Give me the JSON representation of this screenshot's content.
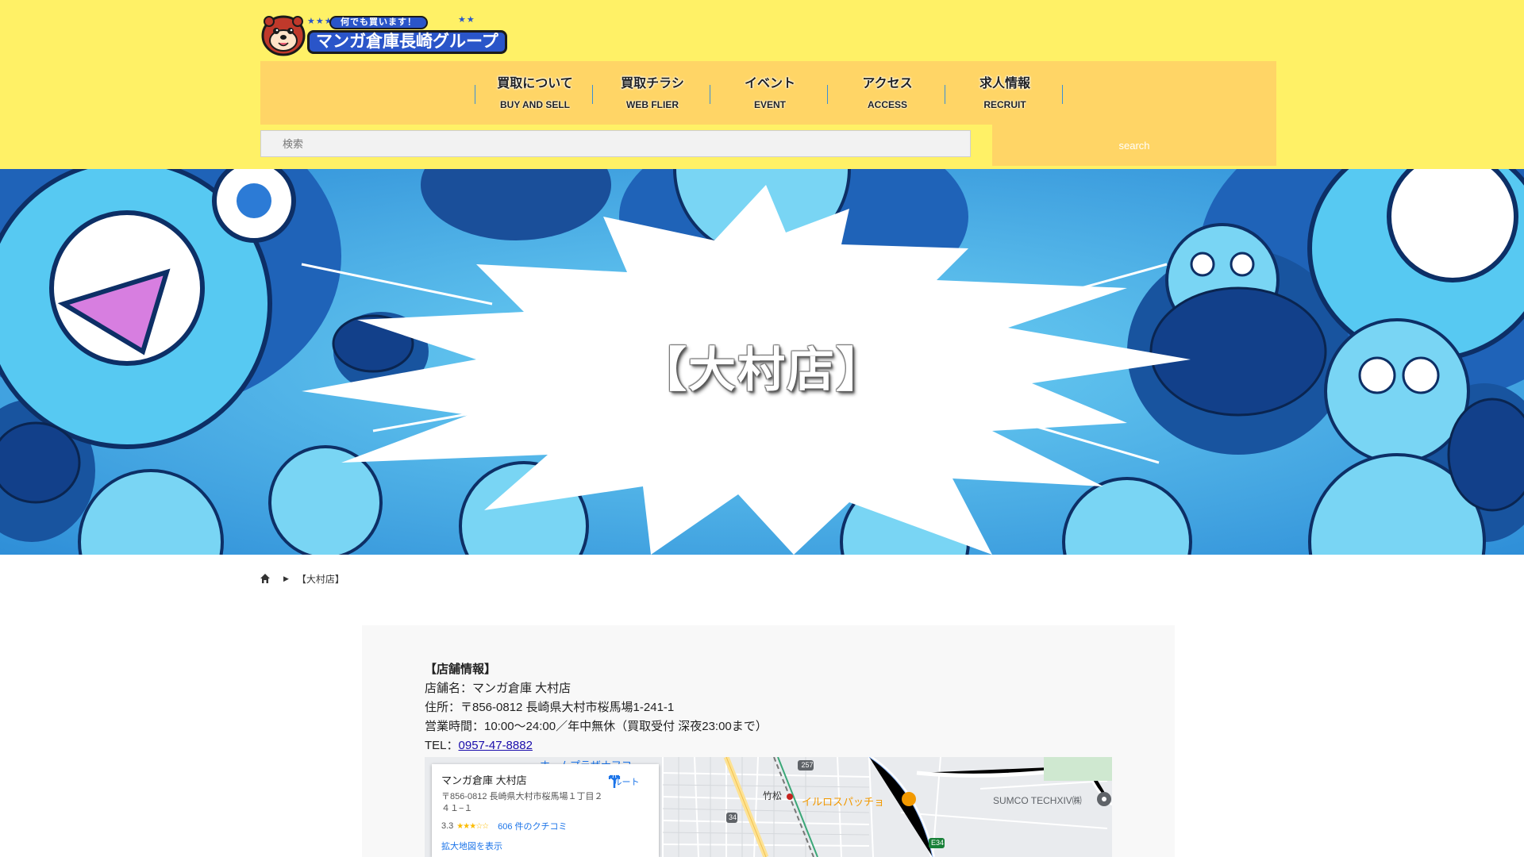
{
  "header": {
    "logo": {
      "tagline": "何でも買います！",
      "name": "マンガ倉庫長崎グループ",
      "stars_left": "★★★",
      "stars_right": "★★"
    },
    "nav": [
      {
        "jp": "買取について",
        "en": "BUY AND SELL"
      },
      {
        "jp": "買取チラシ",
        "en": "WEB FLIER"
      },
      {
        "jp": "イベント",
        "en": "EVENT"
      },
      {
        "jp": "アクセス",
        "en": "ACCESS"
      },
      {
        "jp": "求人情報",
        "en": "RECRUIT"
      }
    ],
    "search": {
      "placeholder": "検索",
      "button_label": "search"
    },
    "colors": {
      "header_bg": "#fff166",
      "nav_bg": "#ffd566"
    }
  },
  "hero": {
    "title": "【大村店】"
  },
  "breadcrumb": {
    "home_icon": "home-icon",
    "separator_icon": "triangle-right-icon",
    "current": "【大村店】"
  },
  "store_info": {
    "heading": "【店舗情報】",
    "name_line": "店舗名：マンガ倉庫 大村店",
    "address_line": "住所：〒856-0812 長崎県大村市桜馬場1-241-1",
    "hours_line": "営業時間：10:00～24:00／年中無休（買取受付 深夜23:00まで）",
    "tel_label": "TEL：",
    "tel_number": "0957-47-8882"
  },
  "map": {
    "card": {
      "name": "マンガ倉庫 大村店",
      "address": "〒856-0812 長崎県大村市桜馬場１丁目２４１−１",
      "rating": "3.3",
      "stars": "★★★☆☆",
      "reviews": "606 件のクチコミ",
      "enlarge_link": "拡大地図を表示",
      "route_label": "ルート"
    },
    "labels": {
      "place_top": "ホームプラザナフコ",
      "takematsu": "竹松",
      "restaurant": "イルロスパッチョ",
      "company": "SUMCO TECHXIV㈱",
      "road_257": "257",
      "road_34": "34",
      "road_e34": "E34"
    }
  }
}
